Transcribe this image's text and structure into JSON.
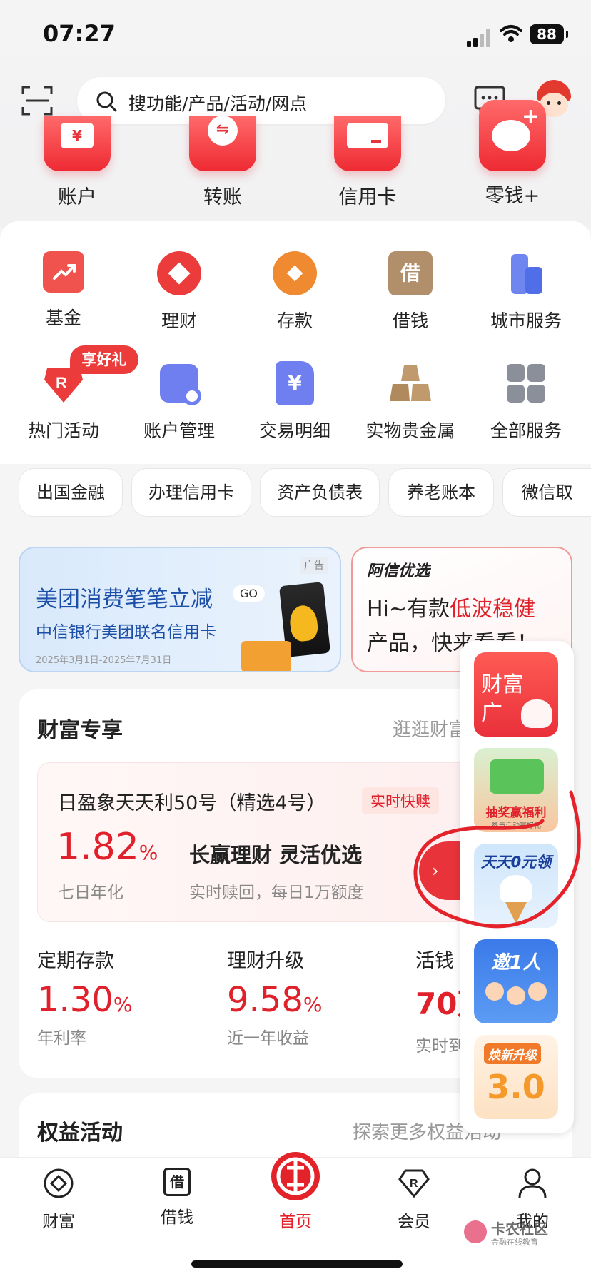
{
  "status_bar": {
    "time": "07:27",
    "battery": "88"
  },
  "search": {
    "placeholder": "搜功能/产品/活动/网点"
  },
  "quick_actions": [
    {
      "label": "账户",
      "icon": "account-wallet-icon"
    },
    {
      "label": "转账",
      "icon": "transfer-icon"
    },
    {
      "label": "信用卡",
      "icon": "credit-card-icon"
    },
    {
      "label": "零钱+",
      "icon": "piggy-bank-icon"
    }
  ],
  "services_row1": [
    {
      "label": "基金",
      "icon": "fund-chart-icon",
      "color": "#f0524e"
    },
    {
      "label": "理财",
      "icon": "wealth-diamond-icon",
      "color": "#ec3b3b"
    },
    {
      "label": "存款",
      "icon": "deposit-coin-icon",
      "color": "#f08a30"
    },
    {
      "label": "借钱",
      "icon": "borrow-icon",
      "color": "#b08f6a",
      "glyph": "借"
    },
    {
      "label": "城市服务",
      "icon": "city-service-icon",
      "color": "#6f86f0"
    }
  ],
  "services_row2": [
    {
      "label": "热门活动",
      "icon": "hot-activity-icon",
      "color": "#ec3b3b",
      "badge": "享好礼"
    },
    {
      "label": "账户管理",
      "icon": "account-manage-icon",
      "color": "#6f7ff0"
    },
    {
      "label": "交易明细",
      "icon": "transaction-detail-icon",
      "color": "#6f7ff0",
      "glyph": "¥"
    },
    {
      "label": "实物贵金属",
      "icon": "gold-bar-icon",
      "color": "#c09a6c"
    },
    {
      "label": "全部服务",
      "icon": "all-services-icon",
      "color": "#8a8f99"
    }
  ],
  "chips": [
    "出国金融",
    "办理信用卡",
    "资产负债表",
    "养老账本",
    "微信取"
  ],
  "banner_left": {
    "ad_tag": "广告",
    "title": "美团消费笔笔立减",
    "go": "GO",
    "subtitle": "中信银行美团联名信用卡",
    "date": "2025年3月1日-2025年7月31日"
  },
  "banner_right": {
    "brand": "阿信优选",
    "line1_prefix": "Hi~有款",
    "line1_highlight": "低波稳健",
    "line2": "产品，快来看看！"
  },
  "wealth": {
    "section_title": "财富专享",
    "more": "逛逛财富",
    "product_name": "日盈象天天利50号（精选4号）",
    "product_tag": "实时快赎",
    "rate": "1.82",
    "rate_unit": "%",
    "rate_label": "七日年化",
    "slogan": "长赢理财 灵活优选",
    "desc": "实时赎回，每日1万额度",
    "items": [
      {
        "title": "定期存款",
        "value": "1.30",
        "unit": "%",
        "label": "年利率"
      },
      {
        "title": "理财升级",
        "value": "9.58",
        "unit": "%",
        "label": "近一年收益"
      },
      {
        "title": "活钱",
        "value": "70万",
        "unit": "",
        "label": "实时到"
      }
    ]
  },
  "equity": {
    "section_title": "权益活动",
    "more": "探索更多权益活动"
  },
  "floating_panel": [
    {
      "text": "财富广",
      "name": "wealth-plaza"
    },
    {
      "text": "抽奖赢福利",
      "sub": "参与活动赢好礼",
      "name": "lottery-welfare"
    },
    {
      "text": "天天0元领",
      "name": "daily-free"
    },
    {
      "text": "邀1人",
      "name": "invite-one"
    },
    {
      "text": "焕新升级",
      "sub": "3.0",
      "name": "upgrade-new"
    }
  ],
  "tabbar": [
    {
      "label": "财富",
      "icon": "wealth-tab-icon"
    },
    {
      "label": "借钱",
      "icon": "borrow-tab-icon",
      "glyph": "借"
    },
    {
      "label": "首页",
      "icon": "home-citic-icon"
    },
    {
      "label": "会员",
      "icon": "member-tab-icon"
    },
    {
      "label": "我的",
      "icon": "profile-tab-icon"
    }
  ],
  "watermark": {
    "name": "卡农社区",
    "sub": "金融在线教育"
  }
}
